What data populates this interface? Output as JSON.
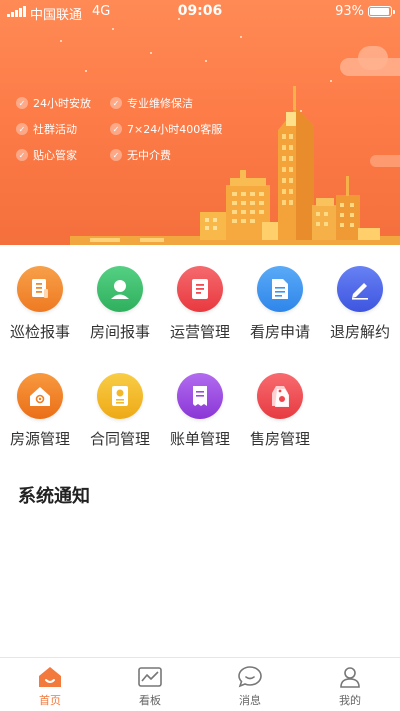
{
  "status_bar": {
    "carrier": "中国联通",
    "network": "4G",
    "time": "09:06",
    "battery": "93%",
    "battery_level": 0.93
  },
  "banner": {
    "features": [
      "24小时安放",
      "专业维修保洁",
      "社群活动",
      "7×24小时400客服",
      "贴心管家",
      "无中介费"
    ]
  },
  "menu": [
    {
      "label": "巡检报事",
      "icon": "inspection-report-icon",
      "color": "#f08a2e"
    },
    {
      "label": "房间报事",
      "icon": "room-report-icon",
      "color": "#3ec06d"
    },
    {
      "label": "运营管理",
      "icon": "operations-icon",
      "color": "#ef4b50"
    },
    {
      "label": "看房申请",
      "icon": "viewing-request-icon",
      "color": "#3b95f2"
    },
    {
      "label": "退房解约",
      "icon": "checkout-icon",
      "color": "#4a64e8"
    },
    {
      "label": "房源管理",
      "icon": "property-icon",
      "color": "#f07f24"
    },
    {
      "label": "合同管理",
      "icon": "contract-icon",
      "color": "#f3b829"
    },
    {
      "label": "账单管理",
      "icon": "bill-icon",
      "color": "#9b4be0"
    },
    {
      "label": "售房管理",
      "icon": "sales-tag-icon",
      "color": "#f0464e"
    }
  ],
  "notice": {
    "title": "系统通知"
  },
  "tabbar": [
    {
      "label": "首页",
      "icon": "home-icon",
      "active": true
    },
    {
      "label": "看板",
      "icon": "dashboard-icon",
      "active": false
    },
    {
      "label": "消息",
      "icon": "message-icon",
      "active": false
    },
    {
      "label": "我的",
      "icon": "profile-icon",
      "active": false
    }
  ],
  "colors": {
    "accent": "#f27a3d",
    "banner": "#fd7c48"
  }
}
